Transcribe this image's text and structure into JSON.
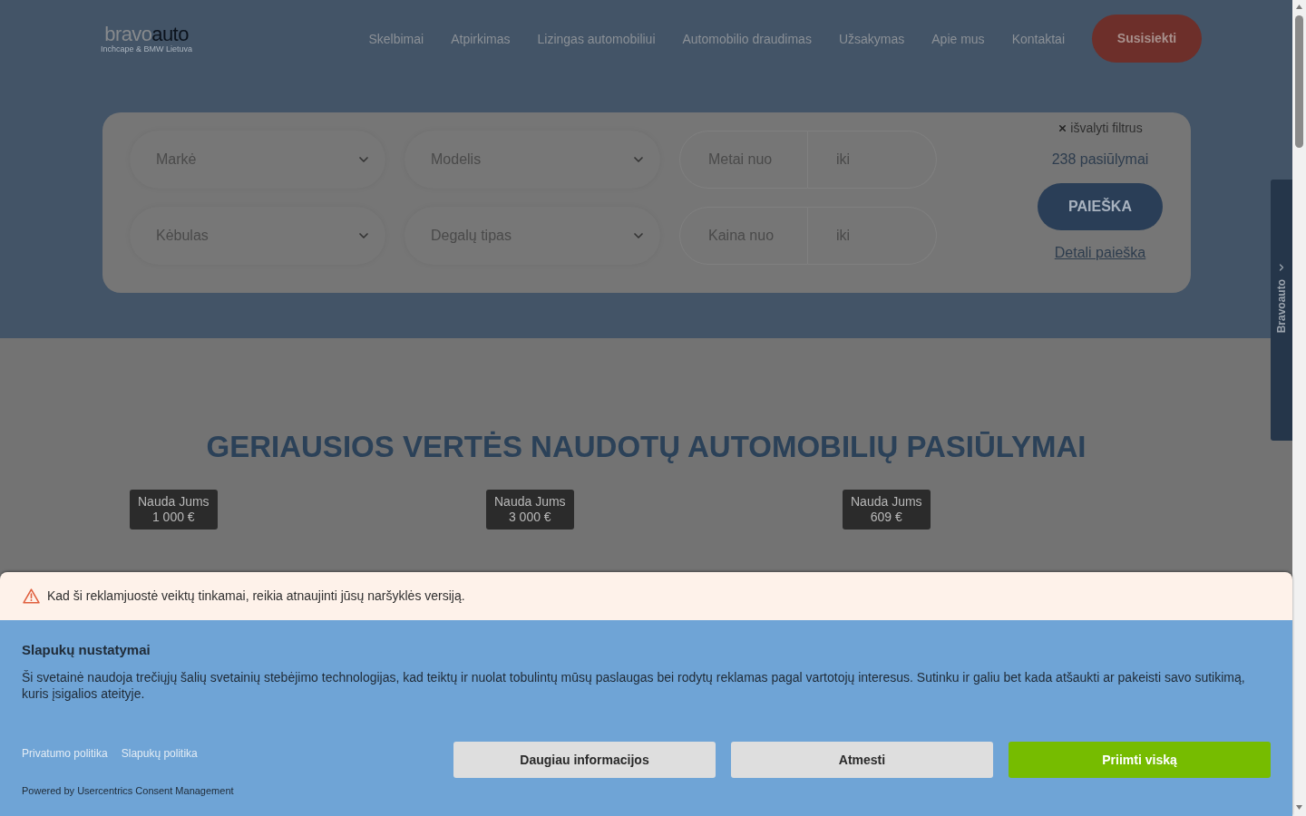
{
  "header": {
    "logo": {
      "brand_light": "bravo",
      "brand_dark": "auto",
      "tagline": "Inchcape & BMW Lietuva"
    },
    "nav": [
      "Skelbimai",
      "Atpirkimas",
      "Lizingas automobiliui",
      "Automobilio draudimas",
      "Užsakymas",
      "Apie mus",
      "Kontaktai"
    ],
    "contact_button": "Susisiekti"
  },
  "search": {
    "filters": [
      {
        "kind": "select",
        "placeholder": "Markė"
      },
      {
        "kind": "select",
        "placeholder": "Modelis"
      },
      {
        "kind": "range",
        "from_placeholder": "Metai nuo",
        "to_placeholder": "iki"
      },
      {
        "kind": "select",
        "placeholder": "Kėbulas"
      },
      {
        "kind": "select",
        "placeholder": "Degalų tipas"
      },
      {
        "kind": "range",
        "from_placeholder": "Kaina nuo",
        "to_placeholder": "iki"
      }
    ],
    "clear_filters": "išvalyti filtrus",
    "results_count": "238 pasiūlymai",
    "search_button": "PAIEŠKA",
    "detail_link": "Detali paieška"
  },
  "side_tab": {
    "label": "Bravoauto"
  },
  "offers": {
    "title": "GERIAUSIOS VERTĖS NAUDOTŲ AUTOMOBILIŲ PASIŪLYMAI",
    "cards": [
      {
        "badge_label": "Nauda Jums",
        "badge_value": "1 000 €"
      },
      {
        "badge_label": "Nauda Jums",
        "badge_value": "3 000 €"
      },
      {
        "badge_label": "Nauda Jums",
        "badge_value": "609 €"
      }
    ]
  },
  "cookie_banner": {
    "warning": "Kad ši reklamjuostė veiktų tinkamai, reikia atnaujinti jūsų naršyklės versiją.",
    "title": "Slapukų nustatymai",
    "text": "Ši svetainė naudoja trečiųjų šalių svetainių stebėjimo technologijas, kad teiktų ir nuolat tobulintų mūsų paslaugas bei rodytų reklamas pagal vartotojų interesus. Sutinku ir galiu bet kada atšaukti ar pakeisti savo sutikimą, kuris įsigalios ateityje.",
    "links": [
      "Privatumo politika",
      "Slapukų politika"
    ],
    "powered_by": "Powered by Usercentrics Consent Management",
    "buttons": [
      {
        "label": "Daugiau informacijos",
        "kind": "secondary"
      },
      {
        "label": "Atmesti",
        "kind": "secondary"
      },
      {
        "label": "Priimti viską",
        "kind": "primary"
      }
    ]
  }
}
